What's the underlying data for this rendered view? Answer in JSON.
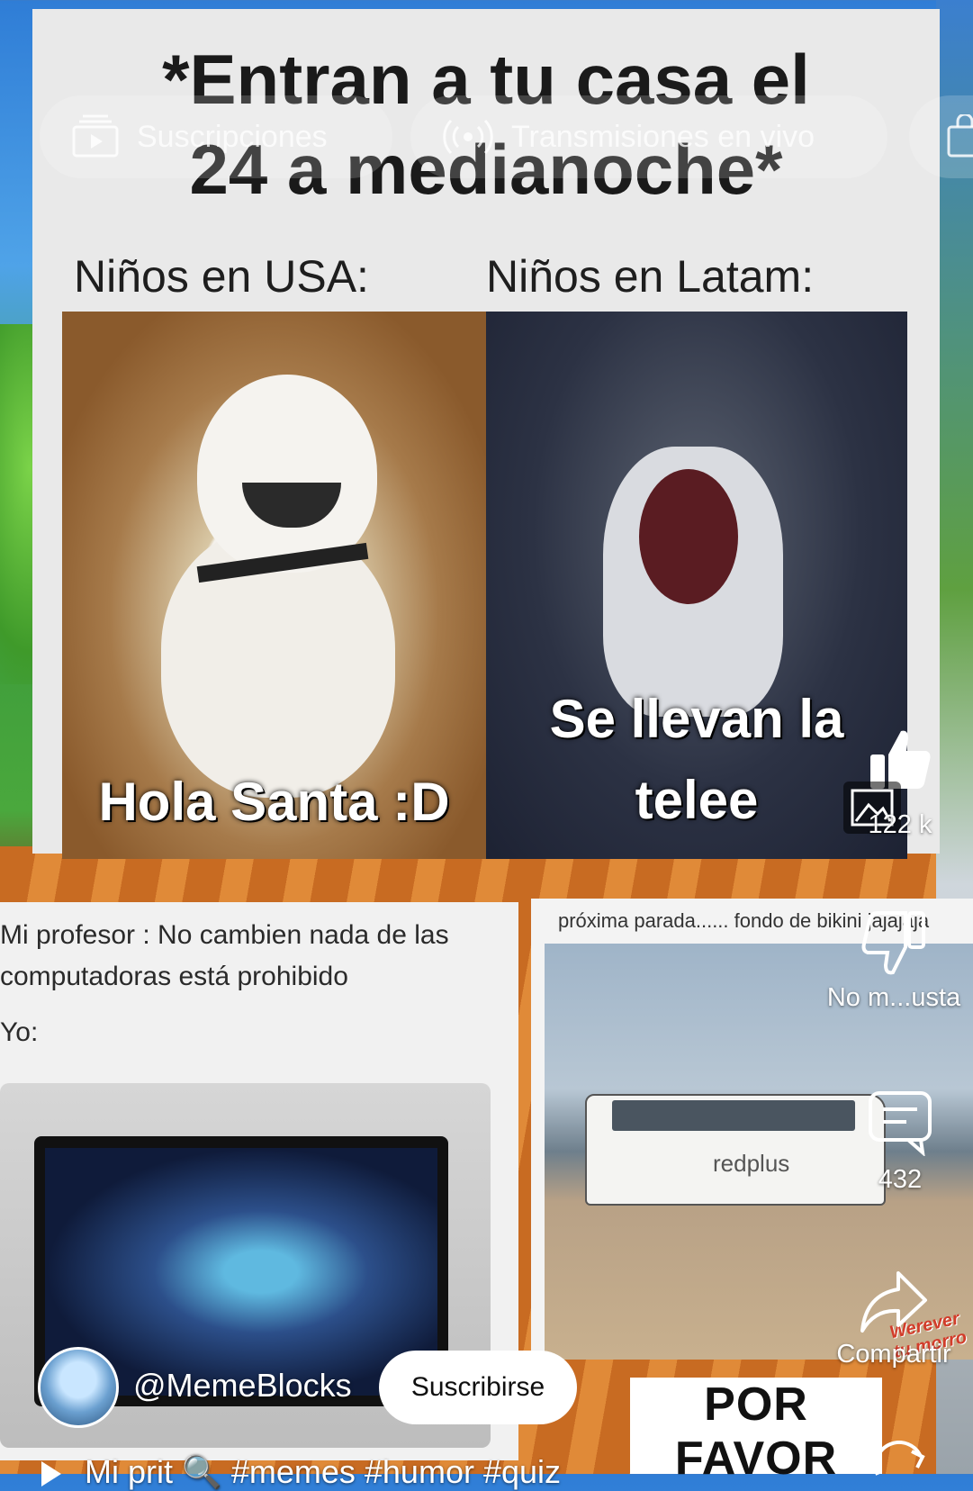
{
  "tabs": [
    {
      "label": "Suscripciones",
      "icon": "subscriptions-icon"
    },
    {
      "label": "Transmisiones en vivo",
      "icon": "live-icon"
    },
    {
      "label": "",
      "icon": "shopping-bag-icon"
    }
  ],
  "meme_top": {
    "title_line1": "*Entran a tu casa el",
    "title_line2": "24 a medianoche*",
    "left_label": "Niños en USA:",
    "right_label": "Niños en Latam:",
    "left_caption": "Hola Santa :D",
    "right_caption_line1": "Se llevan la",
    "right_caption_line2": "telee"
  },
  "meme_bottom_left": {
    "text_line1": "Mi profesor : No cambien nada de las",
    "text_line2": "computadoras está prohibido",
    "text_line3": "Yo:"
  },
  "meme_bottom_right": {
    "caption": "próxima parada...... fondo de bikini jajajaja",
    "bus_text": "redplus"
  },
  "thumbnail_text": "POR FAVOR",
  "watermark": "Werever tu morro",
  "actions": {
    "like_count": "122 k",
    "dislike_label": "No m...usta",
    "comments_count": "432",
    "share_label": "Compartir"
  },
  "channel": {
    "handle": "@MemeBlocks",
    "subscribe_label": "Suscribirse"
  },
  "video_title": "Mi prit 🔍 #memes #humor #quiz",
  "colors": {
    "accent_white": "#ffffff",
    "subscribe_bg": "#ffffff",
    "subscribe_text": "#0f0f0f"
  }
}
